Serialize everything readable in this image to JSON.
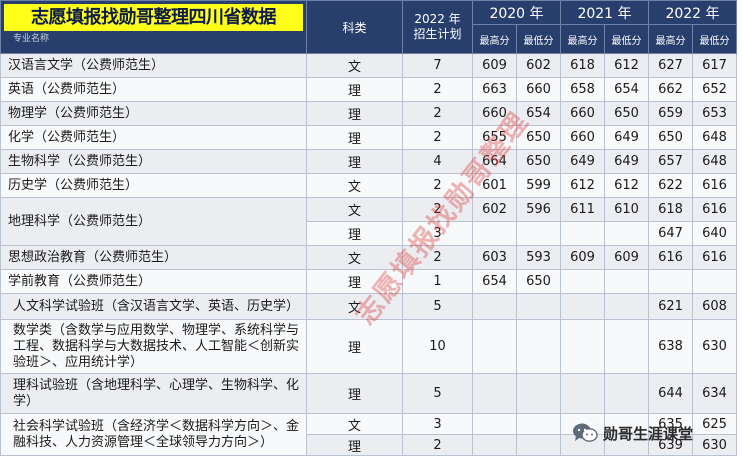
{
  "header": {
    "title_banner": "志愿填报找勋哥整理四川省数据",
    "col_major": "专业名称",
    "col_type": "科类",
    "col_plan_line1": "2022 年",
    "col_plan_line2": "招生计划",
    "year_2020": "2020 年",
    "year_2021": "2021 年",
    "year_2022": "2022 年",
    "max_label": "最高分",
    "min_label": "最低分"
  },
  "rows": [
    {
      "major": "汉语言文学（公费师范生）",
      "type": "文",
      "plan": "7",
      "s2020": [
        "609",
        "602"
      ],
      "s2021": [
        "618",
        "612"
      ],
      "s2022": [
        "627",
        "617"
      ]
    },
    {
      "major": "英语（公费师范生）",
      "type": "理",
      "plan": "2",
      "s2020": [
        "663",
        "660"
      ],
      "s2021": [
        "658",
        "654"
      ],
      "s2022": [
        "662",
        "652"
      ]
    },
    {
      "major": "物理学（公费师范生）",
      "type": "理",
      "plan": "2",
      "s2020": [
        "660",
        "654"
      ],
      "s2021": [
        "660",
        "650"
      ],
      "s2022": [
        "659",
        "653"
      ]
    },
    {
      "major": "化学（公费师范生）",
      "type": "理",
      "plan": "2",
      "s2020": [
        "655",
        "650"
      ],
      "s2021": [
        "660",
        "649"
      ],
      "s2022": [
        "650",
        "648"
      ]
    },
    {
      "major": "生物科学（公费师范生）",
      "type": "理",
      "plan": "4",
      "s2020": [
        "664",
        "650"
      ],
      "s2021": [
        "649",
        "649"
      ],
      "s2022": [
        "657",
        "648"
      ]
    },
    {
      "major": "历史学（公费师范生）",
      "type": "文",
      "plan": "2",
      "s2020": [
        "601",
        "599"
      ],
      "s2021": [
        "612",
        "612"
      ],
      "s2022": [
        "622",
        "616"
      ]
    },
    {
      "major": "地理科学（公费师范生）",
      "type": "文",
      "plan": "2",
      "s2020": [
        "602",
        "596"
      ],
      "s2021": [
        "611",
        "610"
      ],
      "s2022": [
        "618",
        "616"
      ]
    },
    {
      "major": "",
      "type": "理",
      "plan": "3",
      "s2020": [
        "",
        ""
      ],
      "s2021": [
        "",
        ""
      ],
      "s2022": [
        "647",
        "640"
      ]
    },
    {
      "major": "思想政治教育（公费师范生）",
      "type": "文",
      "plan": "2",
      "s2020": [
        "603",
        "593"
      ],
      "s2021": [
        "609",
        "609"
      ],
      "s2022": [
        "616",
        "616"
      ]
    },
    {
      "major": "学前教育（公费师范生）",
      "type": "理",
      "plan": "1",
      "s2020": [
        "654",
        "650"
      ],
      "s2021": [
        "",
        ""
      ],
      "s2022": [
        "",
        ""
      ]
    },
    {
      "major": "人文科学试验班（含汉语言文学、英语、历史学）",
      "type": "文",
      "plan": "5",
      "s2020": [
        "",
        ""
      ],
      "s2021": [
        "",
        ""
      ],
      "s2022": [
        "621",
        "608"
      ]
    },
    {
      "major": "数学类（含数学与应用数学、物理学、系统科学与工程、数据科学与大数据技术、人工智能＜创新实验班＞、应用统计学）",
      "type": "理",
      "plan": "10",
      "s2020": [
        "",
        ""
      ],
      "s2021": [
        "",
        ""
      ],
      "s2022": [
        "638",
        "630"
      ]
    },
    {
      "major": "理科试验班（含地理科学、心理学、生物科学、化学）",
      "type": "理",
      "plan": "5",
      "s2020": [
        "",
        ""
      ],
      "s2021": [
        "",
        ""
      ],
      "s2022": [
        "644",
        "634"
      ]
    },
    {
      "major": "社会科学试验班（含经济学＜数据科学方向＞、金融科技、人力资源管理＜全球领导力方向＞）",
      "type": "文",
      "plan": "3",
      "s2020": [
        "",
        ""
      ],
      "s2021": [
        "",
        ""
      ],
      "s2022": [
        "635",
        "625"
      ]
    },
    {
      "major": "",
      "type": "理",
      "plan": "2",
      "s2020": [
        "",
        ""
      ],
      "s2021": [
        "",
        ""
      ],
      "s2022": [
        "639",
        "630"
      ]
    }
  ],
  "watermark": "志愿填报找勋哥整理",
  "brand": {
    "text": "勋哥生涯课堂",
    "icon": "wechat-icon"
  }
}
